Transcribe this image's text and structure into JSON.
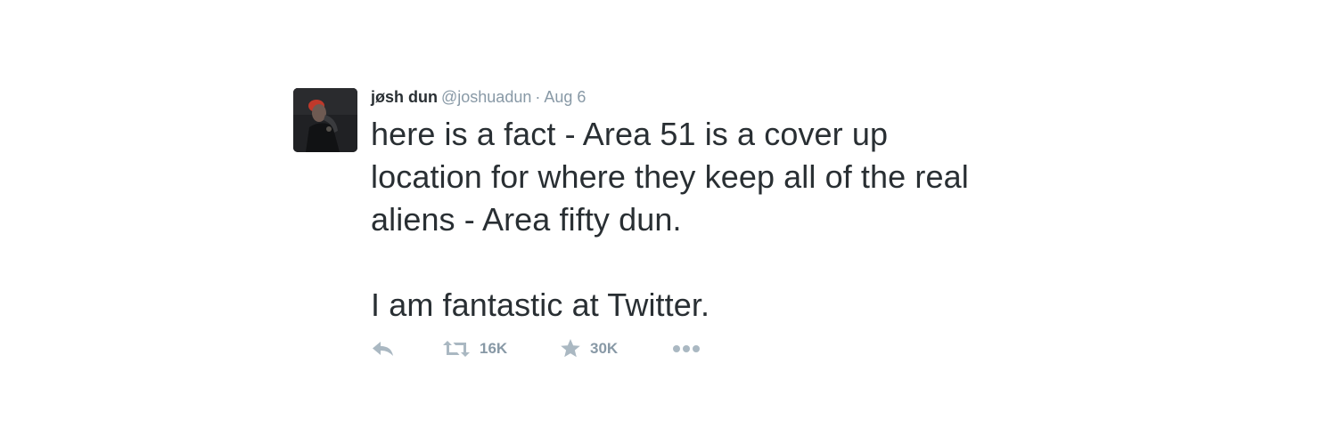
{
  "tweet": {
    "author": {
      "name": "jøsh dun",
      "handle": "@joshuadun"
    },
    "separator": "·",
    "date": "Aug 6",
    "text": "here is a fact - Area 51 is a cover up\nlocation for where they keep all of the real\naliens - Area fifty dun.\n\nI am fantastic at Twitter.",
    "actions": {
      "reply_icon": "reply-icon",
      "retweet_icon": "retweet-icon",
      "retweet_count": "16K",
      "favorite_icon": "star-icon",
      "favorite_count": "30K",
      "more_icon": "more-dots-icon"
    }
  },
  "colors": {
    "text": "#292f33",
    "meta": "#8899a6",
    "icon": "#aab8c2",
    "background": "#ffffff"
  }
}
